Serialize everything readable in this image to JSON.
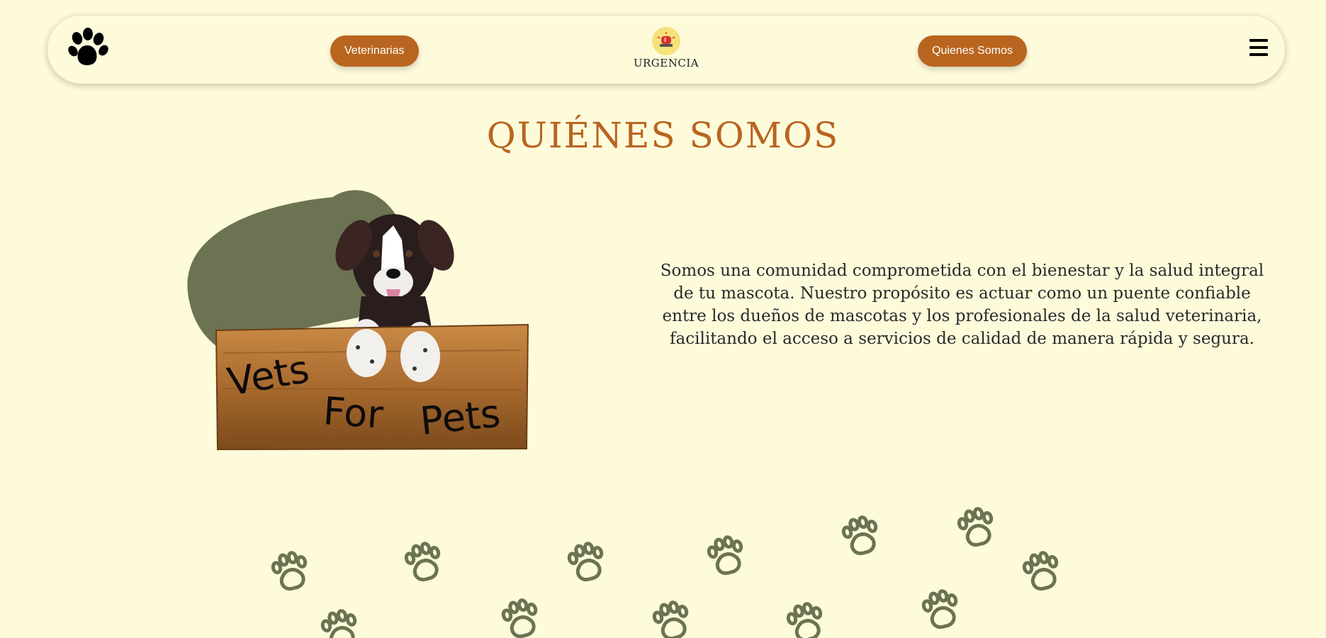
{
  "navbar": {
    "logo_icon": "paw-icon",
    "vets_label": "Veterinarias",
    "urgency_icon": "siren-icon",
    "urgency_label": "URGENCIA",
    "about_label": "Quienes Somos",
    "menu_icon": "hamburger-menu-icon"
  },
  "main": {
    "title": "QUIÉNES SOMOS",
    "sign_text": [
      "Vets",
      "For",
      "Pets"
    ],
    "description": "Somos una comunidad comprometida con el bienestar y la salud integral de tu mascota. Nuestro propósito es actuar como un puente confiable entre los dueños de mascotas y los profesionales de la salud veterinaria, facilitando el acceso a servicios de calidad de manera rápida y segura."
  },
  "colors": {
    "background": "#fefbdb",
    "accent": "#b8651f",
    "blob": "#6b7352",
    "paw": "#6b7352"
  }
}
